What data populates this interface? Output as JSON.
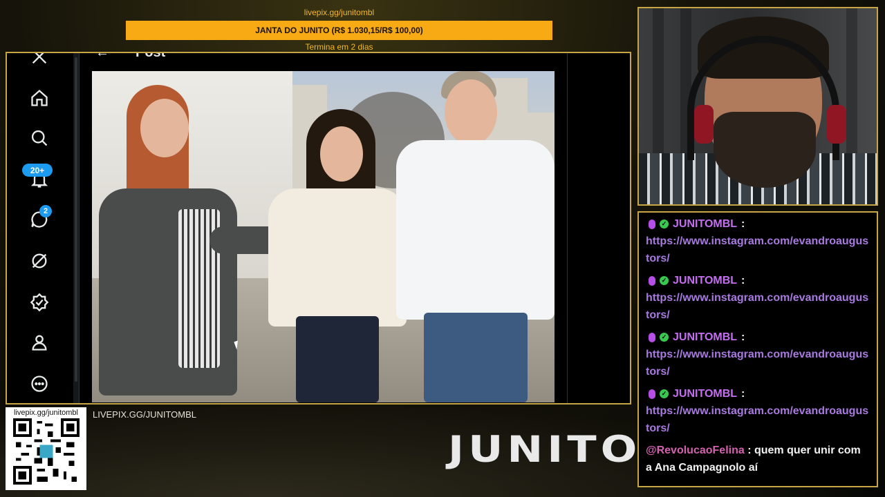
{
  "goal": {
    "link": "livepix.gg/junitombl",
    "bar_text": "JANTA DO JUNITO (R$ 1.030,15/R$ 100,00)",
    "subtext": "Termina em 2 dias"
  },
  "x_app": {
    "header_title": "Post",
    "nav": [
      {
        "name": "x-logo-icon"
      },
      {
        "name": "home-icon"
      },
      {
        "name": "search-icon"
      },
      {
        "name": "bell-icon",
        "badge": "20+"
      },
      {
        "name": "messages-icon",
        "badge": "2"
      },
      {
        "name": "grok-icon"
      },
      {
        "name": "verified-icon"
      },
      {
        "name": "profile-icon"
      },
      {
        "name": "more-icon"
      }
    ]
  },
  "chat": {
    "messages": [
      {
        "user": "JUNITOMBL",
        "text": "https://www.instagram.com/evandroaugustors/"
      },
      {
        "user": "JUNITOMBL",
        "text": "https://www.instagram.com/evandroaugustors/"
      },
      {
        "user": "JUNITOMBL",
        "text": "https://www.instagram.com/evandroaugustors/"
      },
      {
        "user": "JUNITOMBL",
        "text": "https://www.instagram.com/evandroaugustors/"
      },
      {
        "user": "@RevolucaoFelina",
        "text": "quem quer unir com a Ana Campagnolo aí"
      }
    ]
  },
  "overlay": {
    "qr_label": "livepix.gg/junitombl",
    "livepix_text": "LIVEPIX.GG/JUNITOMBL",
    "logo": "JUNITO"
  },
  "colors": {
    "gold": "#c7a646",
    "goal_bar": "#f7aa14",
    "x_blue": "#1d9bf0",
    "chat_user": "#c46ff0"
  }
}
